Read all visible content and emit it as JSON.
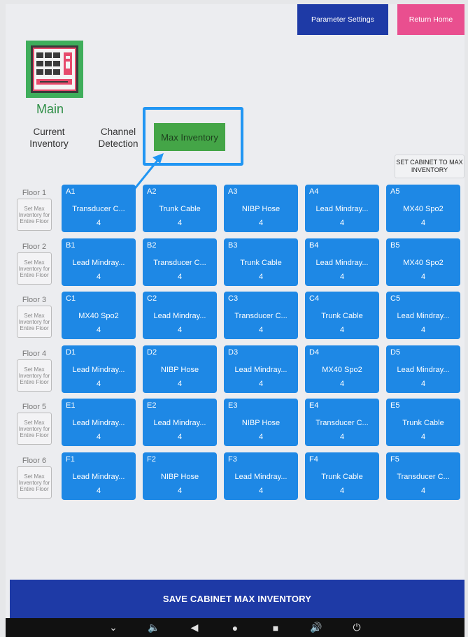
{
  "header": {
    "parameter_settings": "Parameter Settings",
    "return_home": "Return Home"
  },
  "logo": {
    "label": "Main"
  },
  "tabs": {
    "current": "Current Inventory",
    "channel": "Channel Detection",
    "max": "Max Inventory"
  },
  "set_cabinet": "SET CABINET TO MAX INVENTORY",
  "floor_button_label": "Set Max Inventory for Entire Floor",
  "floors": [
    {
      "name": "Floor 1",
      "cells": [
        {
          "id": "A1",
          "name": "Transducer C...",
          "qty": "4"
        },
        {
          "id": "A2",
          "name": "Trunk Cable",
          "qty": "4"
        },
        {
          "id": "A3",
          "name": "NIBP Hose",
          "qty": "4"
        },
        {
          "id": "A4",
          "name": "Lead Mindray...",
          "qty": "4"
        },
        {
          "id": "A5",
          "name": "MX40 Spo2",
          "qty": "4"
        }
      ]
    },
    {
      "name": "Floor 2",
      "cells": [
        {
          "id": "B1",
          "name": "Lead Mindray...",
          "qty": "4"
        },
        {
          "id": "B2",
          "name": "Transducer C...",
          "qty": "4"
        },
        {
          "id": "B3",
          "name": "Trunk Cable",
          "qty": "4"
        },
        {
          "id": "B4",
          "name": "Lead Mindray...",
          "qty": "4"
        },
        {
          "id": "B5",
          "name": "MX40 Spo2",
          "qty": "4"
        }
      ]
    },
    {
      "name": "Floor 3",
      "cells": [
        {
          "id": "C1",
          "name": "MX40 Spo2",
          "qty": "4"
        },
        {
          "id": "C2",
          "name": "Lead Mindray...",
          "qty": "4"
        },
        {
          "id": "C3",
          "name": "Transducer C...",
          "qty": "4"
        },
        {
          "id": "C4",
          "name": "Trunk Cable",
          "qty": "4"
        },
        {
          "id": "C5",
          "name": "Lead Mindray...",
          "qty": "4"
        }
      ]
    },
    {
      "name": "Floor 4",
      "cells": [
        {
          "id": "D1",
          "name": "Lead Mindray...",
          "qty": "4"
        },
        {
          "id": "D2",
          "name": "NIBP Hose",
          "qty": "4"
        },
        {
          "id": "D3",
          "name": "Lead Mindray...",
          "qty": "4"
        },
        {
          "id": "D4",
          "name": "MX40 Spo2",
          "qty": "4"
        },
        {
          "id": "D5",
          "name": "Lead Mindray...",
          "qty": "4"
        }
      ]
    },
    {
      "name": "Floor 5",
      "cells": [
        {
          "id": "E1",
          "name": "Lead Mindray...",
          "qty": "4"
        },
        {
          "id": "E2",
          "name": "Lead Mindray...",
          "qty": "4"
        },
        {
          "id": "E3",
          "name": "NIBP Hose",
          "qty": "4"
        },
        {
          "id": "E4",
          "name": "Transducer C...",
          "qty": "4"
        },
        {
          "id": "E5",
          "name": "Trunk Cable",
          "qty": "4"
        }
      ]
    },
    {
      "name": "Floor 6",
      "cells": [
        {
          "id": "F1",
          "name": "Lead Mindray...",
          "qty": "4"
        },
        {
          "id": "F2",
          "name": "NIBP Hose",
          "qty": "4"
        },
        {
          "id": "F3",
          "name": "Lead Mindray...",
          "qty": "4"
        },
        {
          "id": "F4",
          "name": "Trunk Cable",
          "qty": "4"
        },
        {
          "id": "F5",
          "name": "Transducer C...",
          "qty": "4"
        }
      ]
    }
  ],
  "save_button": "SAVE CABINET MAX INVENTORY",
  "navbar_icons": [
    "chevron-down-icon",
    "volume-down-icon",
    "back-icon",
    "home-icon",
    "recents-icon",
    "volume-up-icon",
    "power-icon"
  ],
  "colors": {
    "cell_blue": "#1e88e5",
    "header_blue": "#1e3aa6",
    "home_pink": "#e94f8f",
    "active_tab_green": "#44a547",
    "highlight_blue": "#2196f3"
  }
}
